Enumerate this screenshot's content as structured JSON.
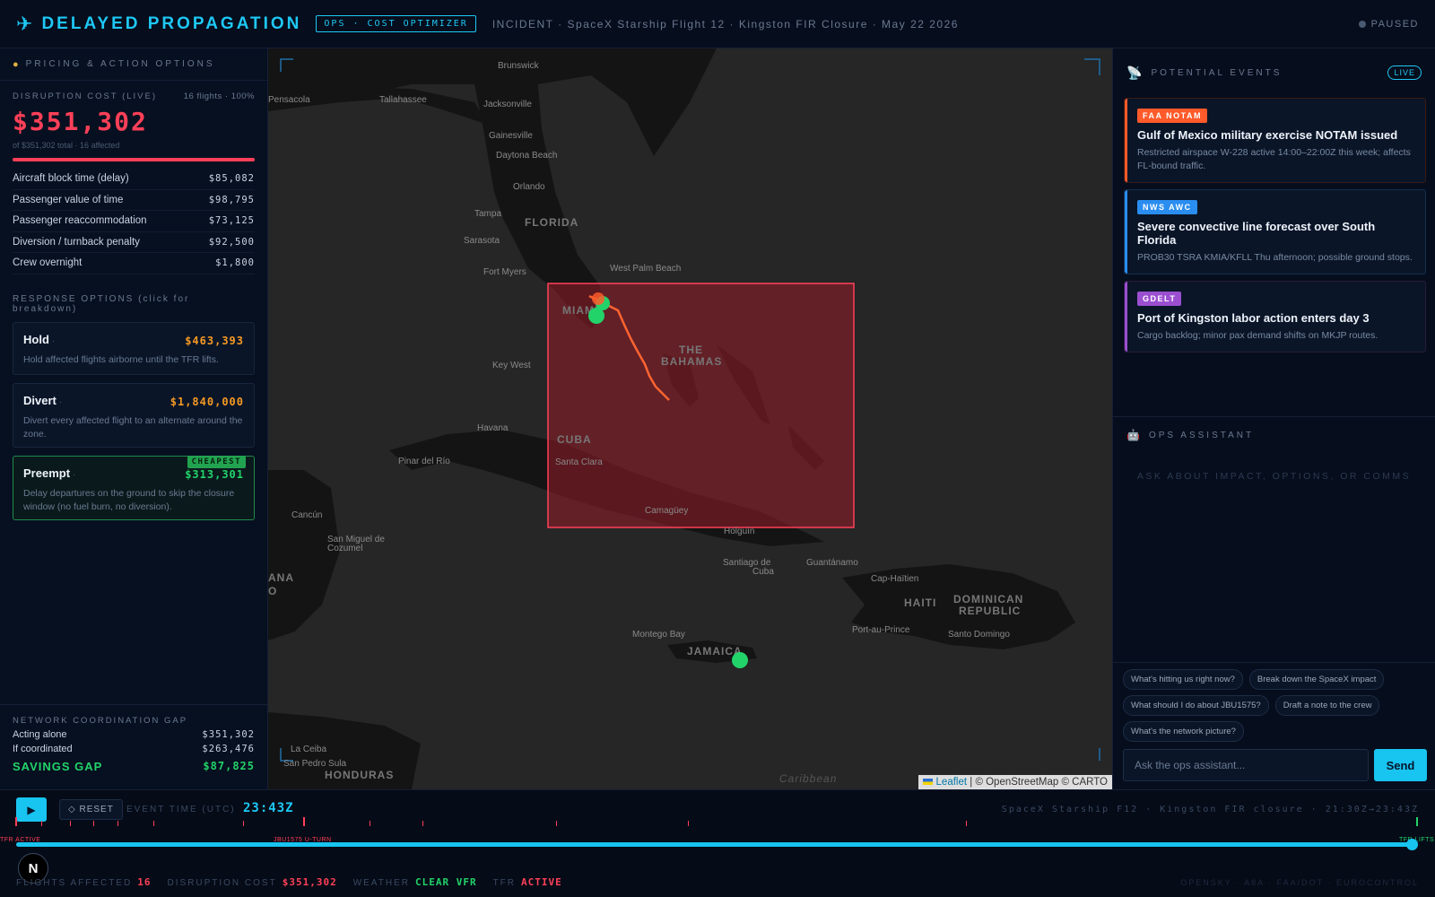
{
  "header": {
    "title": "DELAYED PROPAGATION",
    "tag": "OPS · COST OPTIMIZER",
    "incident": "INCIDENT · SpaceX Starship Flight 12 · Kingston FIR Closure · May 22 2026",
    "status": "PAUSED"
  },
  "left": {
    "section_title": "PRICING & ACTION OPTIONS",
    "cost_label": "DISRUPTION COST (LIVE)",
    "cost_meta": "16 flights · 100%",
    "cost_value": "$351,302",
    "cost_sub": "of $351,302 total · 16 affected",
    "cost_fraction": 1.0,
    "breakdown": [
      {
        "label": "Aircraft block time (delay)",
        "value": "$85,082"
      },
      {
        "label": "Passenger value of time",
        "value": "$98,795"
      },
      {
        "label": "Passenger reaccommodation",
        "value": "$73,125"
      },
      {
        "label": "Diversion / turnback penalty",
        "value": "$92,500"
      },
      {
        "label": "Crew overnight",
        "value": "$1,800"
      }
    ],
    "response_title": "RESPONSE OPTIONS (click for breakdown)",
    "options": [
      {
        "name": "Hold",
        "price": "$463,393",
        "desc": "Hold affected flights airborne until the TFR lifts."
      },
      {
        "name": "Divert",
        "price": "$1,840,000",
        "desc": "Divert every affected flight to an alternate around the zone."
      },
      {
        "name": "Preempt",
        "price": "$313,301",
        "badge": "CHEAPEST",
        "desc": "Delay departures on the ground to skip the closure window (no fuel burn, no diversion)."
      }
    ],
    "gap": {
      "title": "NETWORK COORDINATION GAP",
      "alone_label": "Acting alone",
      "alone_value": "$351,302",
      "coord_label": "If coordinated",
      "coord_value": "$263,476",
      "savings_label": "SAVINGS GAP",
      "savings_value": "$87,825"
    }
  },
  "map": {
    "labels": {
      "brunswick": "Brunswick",
      "pensacola": "Pensacola",
      "tallahassee": "Tallahassee",
      "jacksonville": "Jacksonville",
      "gainesville": "Gainesville",
      "daytona": "Daytona Beach",
      "orlando": "Orlando",
      "tampa": "Tampa",
      "florida": "FLORIDA",
      "sarasota": "Sarasota",
      "fortmyers": "Fort Myers",
      "wpb": "West Palm Beach",
      "miami": "MIAMI",
      "keywest": "Key West",
      "bahamas1": "THE",
      "bahamas2": "BAHAMAS",
      "havana": "Havana",
      "cuba": "CUBA",
      "pinar": "Pinar del Río",
      "santaclara": "Santa Clara",
      "camaguey": "Camagüey",
      "cancun": "Cancún",
      "sanmiguel1": "San Miguel de",
      "sanmiguel2": "Cozumel",
      "holguin": "Holguín",
      "santiago1": "Santiago de",
      "santiago2": "Cuba",
      "guantanamo": "Guantánamo",
      "caphaitien": "Cap-Haïtien",
      "haiti": "HAITI",
      "dominican1": "DOMINICAN",
      "dominican2": "REPUBLIC",
      "portauprince": "Port-au-Prince",
      "santodomingo": "Santo Domingo",
      "montego": "Montego Bay",
      "jamaica": "JAMAICA",
      "ana": "ANA",
      "o": "O",
      "laceiba": "La Ceiba",
      "sanpedro": "San Pedro Sula",
      "honduras": "HONDURAS",
      "caribbean": "Caribbean"
    },
    "attribution_leaflet": "Leaflet",
    "attribution_rest": " | © OpenStreetMap © CARTO"
  },
  "right": {
    "events_title": "POTENTIAL EVENTS",
    "live": "LIVE",
    "events": [
      {
        "source": "FAA NOTAM",
        "title": "Gulf of Mexico military exercise NOTAM issued",
        "desc": "Restricted airspace W-228 active 14:00–22:00Z this week; affects FL-bound traffic.",
        "color": "#ff5a2a"
      },
      {
        "source": "NWS AWC",
        "title": "Severe convective line forecast over South Florida",
        "desc": "PROB30 TSRA KMIA/KFLL Thu afternoon; possible ground stops.",
        "color": "#2a8df0"
      },
      {
        "source": "GDELT",
        "title": "Port of Kingston labor action enters day 3",
        "desc": "Cargo backlog; minor pax demand shifts on MKJP routes.",
        "color": "#9b4fd0"
      }
    ],
    "assistant_title": "OPS ASSISTANT",
    "assistant_placeholder": "ASK ABOUT IMPACT, OPTIONS, OR COMMS",
    "chips": [
      "What's hitting us right now?",
      "Break down the SpaceX impact",
      "What should I do about JBU1575?",
      "Draft a note to the crew",
      "What's the network picture?"
    ],
    "input_placeholder": "Ask the ops assistant...",
    "send": "Send"
  },
  "bottom": {
    "reset": "◇ RESET",
    "event_time_label": "EVENT TIME (UTC)",
    "event_time": "23:43Z",
    "scenario": "SpaceX Starship F12 · Kingston FIR closure · 21:30Z→23:43Z",
    "progress_fraction": 1.0,
    "marker_tfr_active": "TFR ACTIVE",
    "marker_uturn": "JBU1575 U-TURN",
    "marker_tfr_lifts": "TFR LIFTS",
    "stats": [
      {
        "label": "FLIGHTS AFFECTED",
        "value": "16",
        "color": "#ff4058"
      },
      {
        "label": "DISRUPTION COST",
        "value": "$351,302",
        "color": "#ff4058"
      },
      {
        "label": "WEATHER",
        "value": "CLEAR VFR",
        "color": "#22d36a"
      },
      {
        "label": "TFR",
        "value": "ACTIVE",
        "color": "#ff4058"
      }
    ],
    "sources": "OPENSKY · A8A · FAA/DOT · EUROCONTROL",
    "logo": "N"
  }
}
